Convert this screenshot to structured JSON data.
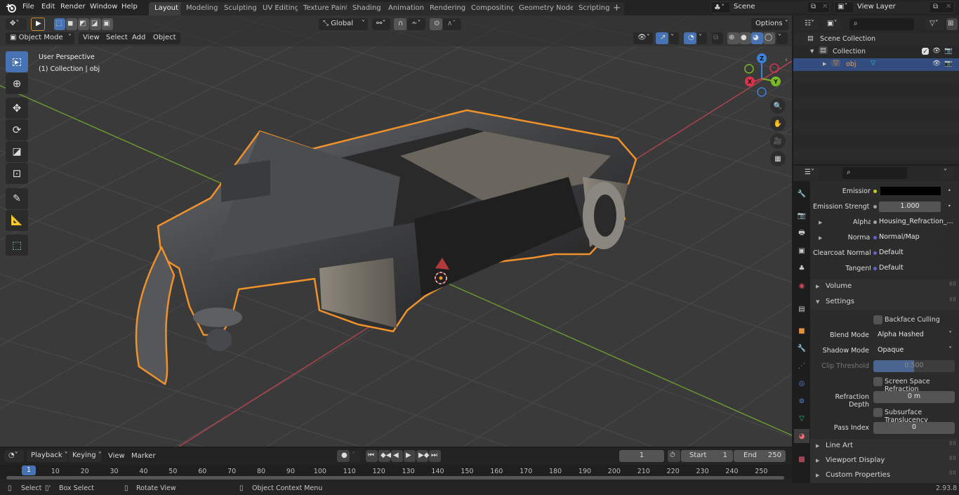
{
  "app": {
    "menu": [
      "File",
      "Edit",
      "Render",
      "Window",
      "Help"
    ],
    "workspace_tabs": [
      "Layout",
      "Modeling",
      "Sculpting",
      "UV Editing",
      "Texture Paint",
      "Shading",
      "Animation",
      "Rendering",
      "Compositing",
      "Geometry Nodes",
      "Scripting"
    ],
    "active_tab": "Layout",
    "add_tab": "+",
    "scene": "Scene",
    "view_layer": "View Layer",
    "version": "2.93.8"
  },
  "viewport": {
    "mode": "Object Mode",
    "header_menus": [
      "View",
      "Select",
      "Add",
      "Object"
    ],
    "transform_orientation": "Global",
    "options": "Options",
    "overlay_title": "User Perspective",
    "overlay_subtitle": "(1) Collection | obj",
    "gizmo": {
      "x": "X",
      "y": "Y",
      "z": "Z"
    },
    "colors": {
      "selection_outline": "#f0922b",
      "x_axis": "#c8464f",
      "y_axis": "#6ea02c",
      "active_blue": "#4772b3"
    },
    "tools": [
      "select-box-icon",
      "cursor-icon",
      "move-icon",
      "rotate-icon",
      "scale-icon",
      "transform-icon",
      "annotate-icon",
      "measure-icon",
      "add-cube-icon"
    ],
    "nav_buttons": [
      "zoom-icon",
      "pan-hand-icon",
      "camera-icon",
      "ortho-grid-icon"
    ]
  },
  "outliner": {
    "search_placeholder": "",
    "rows": [
      {
        "label": "Scene Collection",
        "level": 0
      },
      {
        "label": "Collection",
        "level": 1,
        "checked": true
      },
      {
        "label": "obj",
        "level": 2,
        "selected": true
      }
    ]
  },
  "properties": {
    "search_placeholder": "",
    "inputs": [
      {
        "label": "Emission",
        "value": "",
        "socket_color": "#c7c729",
        "kind": "color",
        "color": "#000000"
      },
      {
        "label": "Emission Strengt",
        "value": "1.000",
        "socket_color": "#a1a1a1",
        "kind": "number"
      },
      {
        "label": "Alpha",
        "value": "Housing_Refraction_...",
        "socket_color": "#a1a1a1",
        "kind": "link",
        "expandable": true
      },
      {
        "label": "Normal",
        "value": "Normal/Map",
        "socket_color": "#6363c7",
        "kind": "link",
        "expandable": true
      },
      {
        "label": "Clearcoat Normal",
        "value": "Default",
        "socket_color": "#6363c7",
        "kind": "link"
      },
      {
        "label": "Tangent",
        "value": "Default",
        "socket_color": "#6363c7",
        "kind": "link"
      }
    ],
    "panels": {
      "volume": "Volume",
      "settings": "Settings",
      "line_art": "Line Art",
      "viewport_display": "Viewport Display",
      "custom_properties": "Custom Properties"
    },
    "settings": {
      "backface_culling": {
        "label": "Backface Culling",
        "checked": false
      },
      "blend_mode": {
        "label": "Blend Mode",
        "value": "Alpha Hashed"
      },
      "shadow_mode": {
        "label": "Shadow Mode",
        "value": "Opaque"
      },
      "clip_threshold": {
        "label": "Clip Threshold",
        "value": "0.500",
        "fraction": 0.5,
        "disabled": true
      },
      "screen_space_refraction": {
        "label": "Screen Space Refraction",
        "checked": false
      },
      "refraction_depth": {
        "label": "Refraction Depth",
        "value": "0 m"
      },
      "subsurface_translucency": {
        "label": "Subsurface Translucency",
        "checked": false
      },
      "pass_index": {
        "label": "Pass Index",
        "value": "0"
      }
    },
    "tabs": [
      "tool",
      "render",
      "output",
      "view-layer",
      "scene",
      "world",
      "collection",
      "object",
      "modifiers",
      "particles",
      "physics",
      "constraints",
      "data",
      "material",
      "texture"
    ],
    "active_tab": "material"
  },
  "timeline": {
    "menus": [
      "Playback",
      "Keying",
      "View",
      "Marker"
    ],
    "current_frame": "1",
    "start_label": "Start",
    "start": "1",
    "end_label": "End",
    "end": "250",
    "ruler": [
      "10",
      "20",
      "30",
      "40",
      "50",
      "60",
      "70",
      "80",
      "90",
      "100",
      "110",
      "120",
      "130",
      "140",
      "150",
      "160",
      "170",
      "180",
      "190",
      "200",
      "210",
      "220",
      "230",
      "240",
      "250"
    ],
    "playhead": "1"
  },
  "statusbar": {
    "items": [
      "Select",
      "Box Select",
      "Rotate View",
      "Object Context Menu"
    ]
  }
}
